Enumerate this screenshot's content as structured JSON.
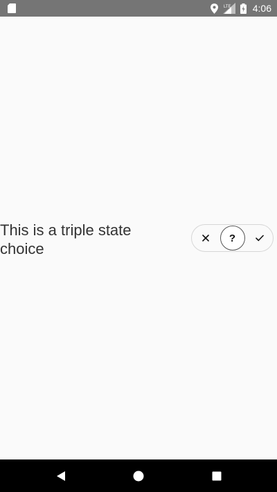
{
  "status_bar": {
    "time": "4:06",
    "network_label": "LTE",
    "icons": [
      "sd-card-icon",
      "location-icon",
      "signal-icon",
      "battery-icon"
    ]
  },
  "main": {
    "choice_label": "This is a triple state choice",
    "toggle": {
      "options": [
        {
          "name": "no",
          "glyph": "×",
          "icon": "close-icon"
        },
        {
          "name": "unknown",
          "glyph": "?",
          "icon": "question-icon"
        },
        {
          "name": "yes",
          "glyph": "✓",
          "icon": "check-icon"
        }
      ],
      "selected": "unknown"
    }
  },
  "nav_bar": {
    "buttons": [
      "back-icon",
      "home-icon",
      "recents-icon"
    ]
  },
  "colors": {
    "background": "#fafafa",
    "status_bar": "#757575",
    "nav_bar": "#000000",
    "text": "#333333",
    "toggle_border": "#d6d6d6"
  }
}
